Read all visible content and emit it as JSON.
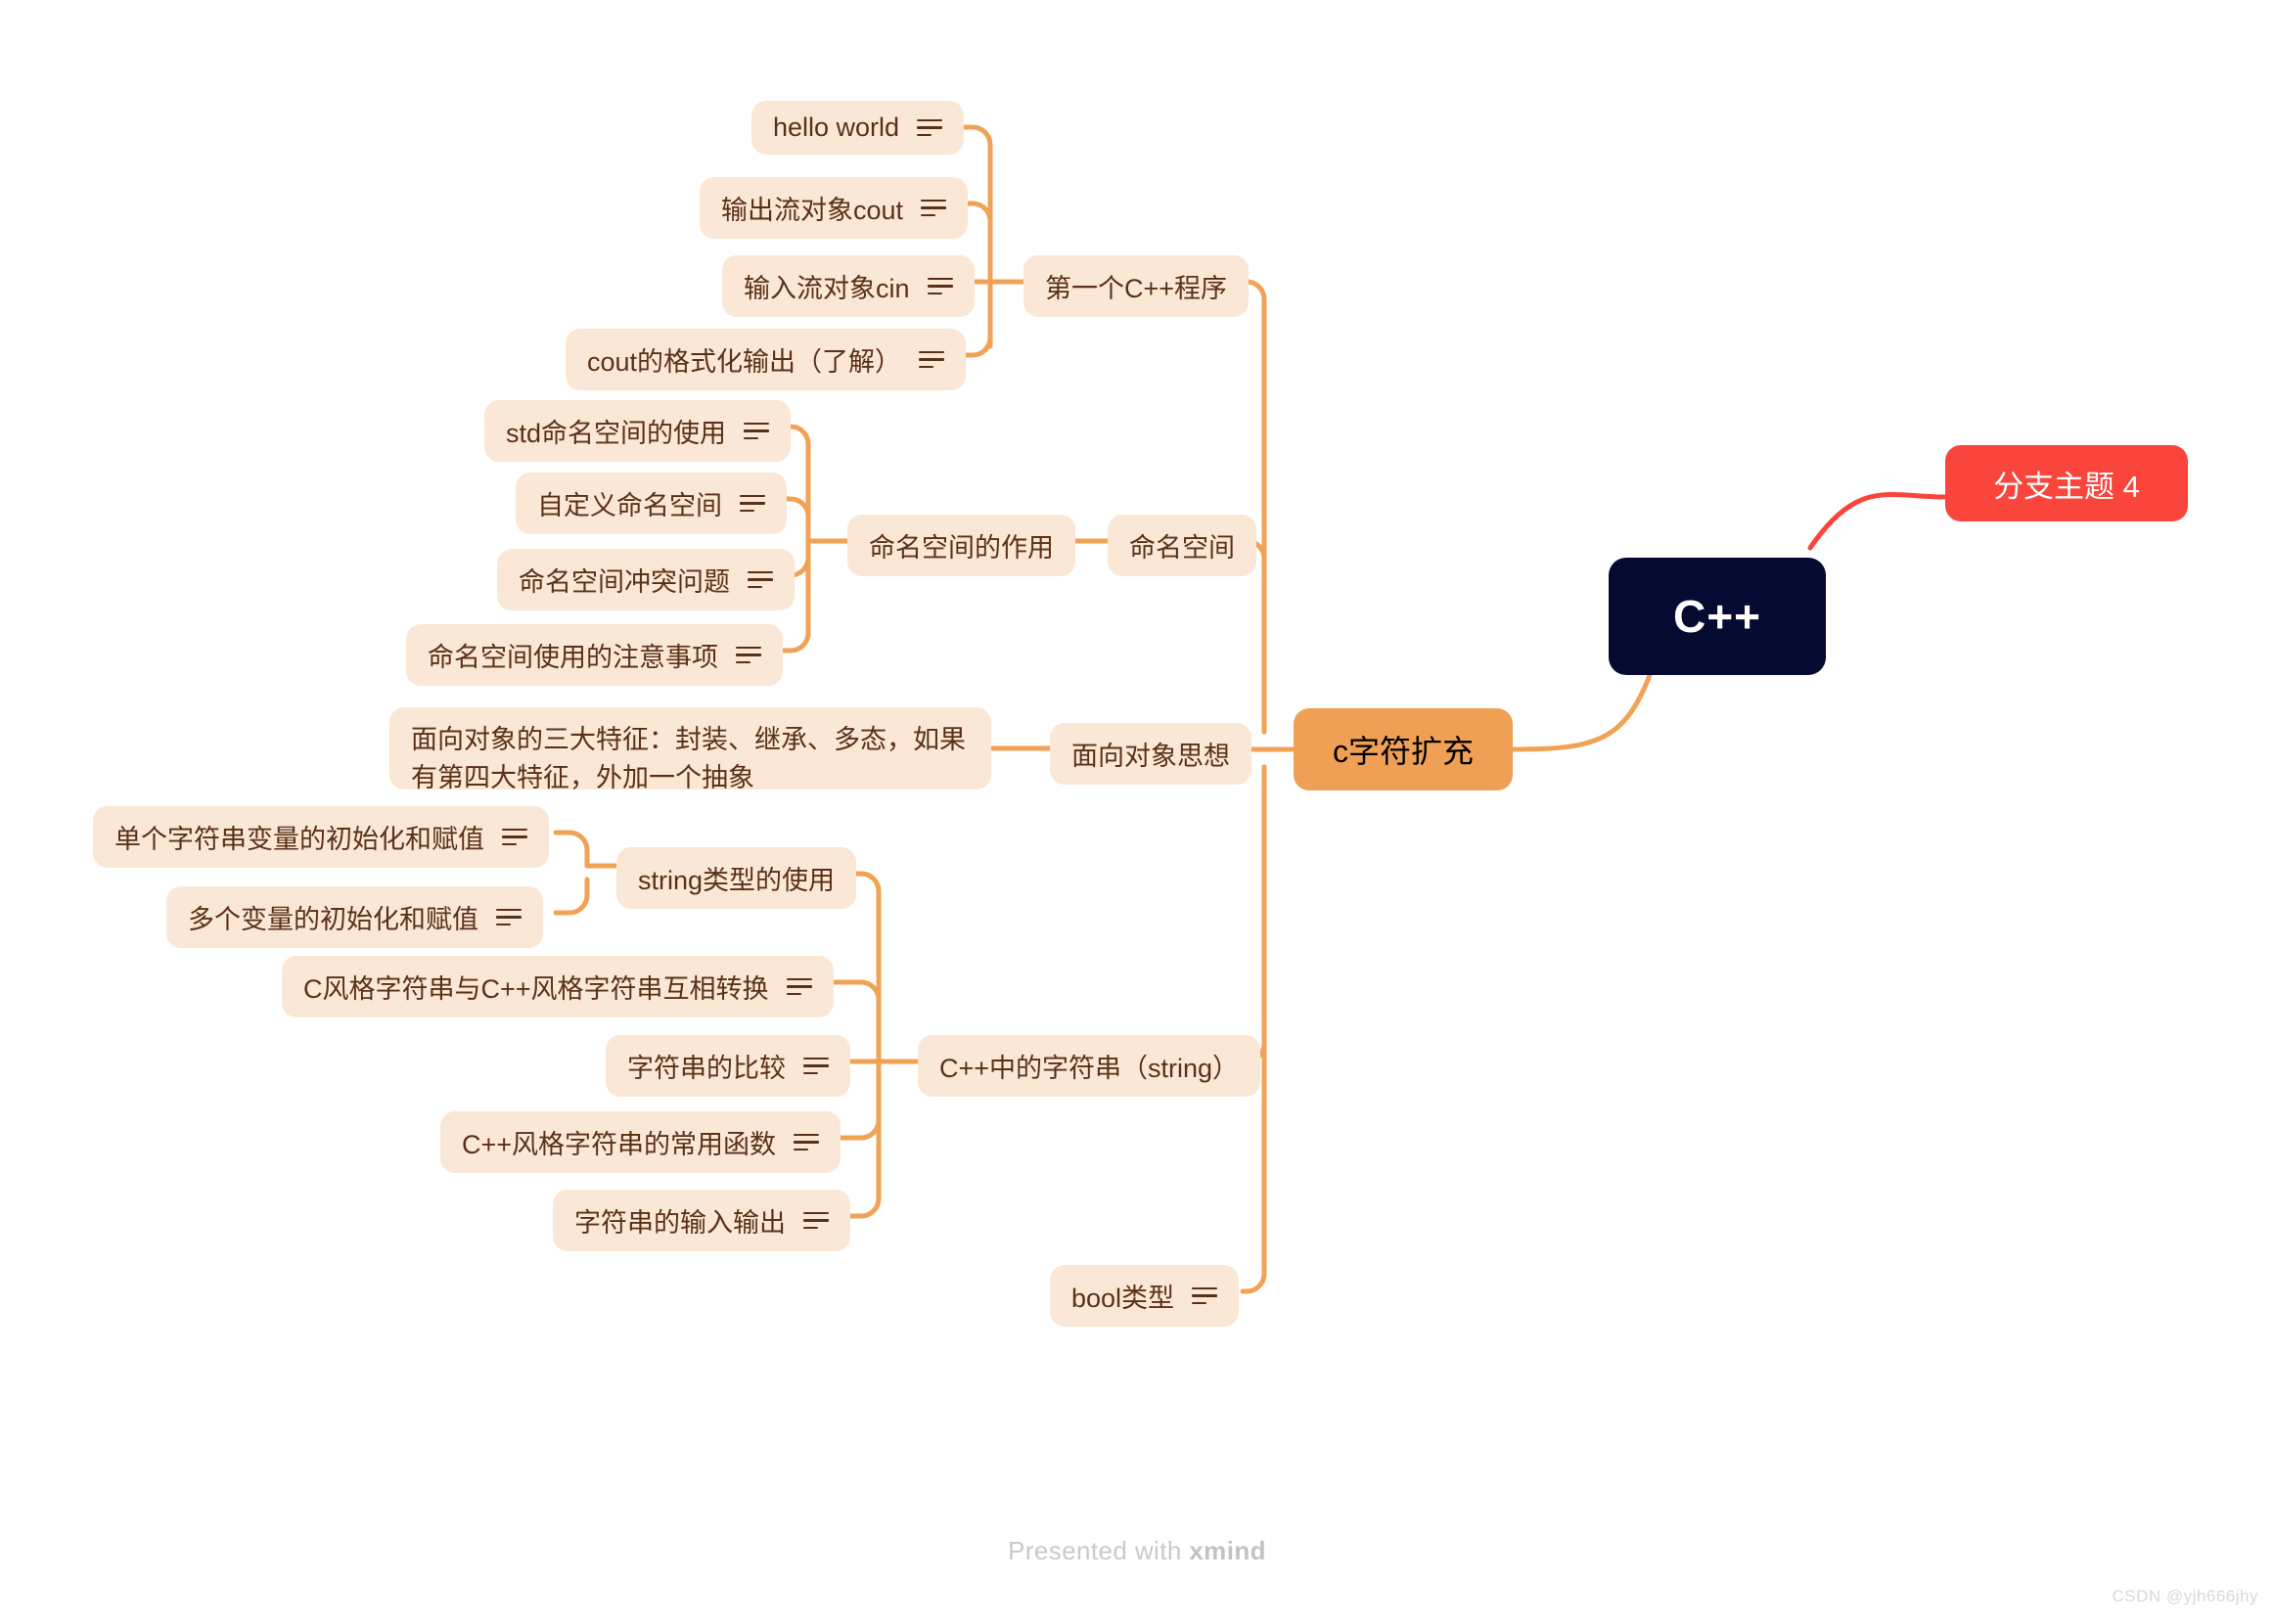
{
  "meta": {
    "colors": {
      "background": "#FFFFFF",
      "leaf_fill": "#FBE7D6",
      "leaf_text": "#5A3117",
      "connector_orange": "#F2A254",
      "connector_red": "#F9453B",
      "root_fill": "#050A30",
      "root_text": "#FFFFFF",
      "main_fill": "#F0A055",
      "main_text": "#000000",
      "red_fill": "#F9453B",
      "red_text": "#FFFFFF",
      "watermark": "#C9C9C9"
    }
  },
  "root": {
    "label": "C++"
  },
  "topics": {
    "c_extension": "c字符扩充",
    "branch4": "分支主题 4"
  },
  "branches": [
    {
      "id": "first-program",
      "label": "第一个C++程序",
      "has_notes": false,
      "children": [
        {
          "label": "hello world",
          "has_notes": true
        },
        {
          "label": "输出流对象cout",
          "has_notes": true
        },
        {
          "label": "输入流对象cin",
          "has_notes": true
        },
        {
          "label": "cout的格式化输出（了解）",
          "has_notes": true
        }
      ]
    },
    {
      "id": "namespace",
      "label": "命名空间",
      "has_notes": false,
      "children": [
        {
          "label": "命名空间的作用",
          "has_notes": false,
          "children": [
            {
              "label": "std命名空间的使用",
              "has_notes": true
            },
            {
              "label": "自定义命名空间",
              "has_notes": true
            },
            {
              "label": "命名空间冲突问题",
              "has_notes": true
            },
            {
              "label": "命名空间使用的注意事项",
              "has_notes": true
            }
          ]
        }
      ]
    },
    {
      "id": "oop",
      "label": "面向对象思想",
      "has_notes": false,
      "children": [
        {
          "label": "面向对象的三大特征：封装、继承、多态，如果有第四大特征，外加一个抽象",
          "has_notes": false
        }
      ]
    },
    {
      "id": "cpp-string",
      "label": "C++中的字符串（string）",
      "has_notes": false,
      "children": [
        {
          "label": "string类型的使用",
          "has_notes": false,
          "children": [
            {
              "label": "单个字符串变量的初始化和赋值",
              "has_notes": true
            },
            {
              "label": "多个变量的初始化和赋值",
              "has_notes": true
            }
          ]
        },
        {
          "label": "C风格字符串与C++风格字符串互相转换",
          "has_notes": true
        },
        {
          "label": "字符串的比较",
          "has_notes": true
        },
        {
          "label": "C++风格字符串的常用函数",
          "has_notes": true
        },
        {
          "label": "字符串的输入输出",
          "has_notes": true
        }
      ]
    },
    {
      "id": "bool-type",
      "label": "bool类型",
      "has_notes": true,
      "children": []
    }
  ],
  "footer": {
    "credit_prefix": "Presented with ",
    "credit_brand": "xmind",
    "watermark": "CSDN @yjh666jhy"
  }
}
